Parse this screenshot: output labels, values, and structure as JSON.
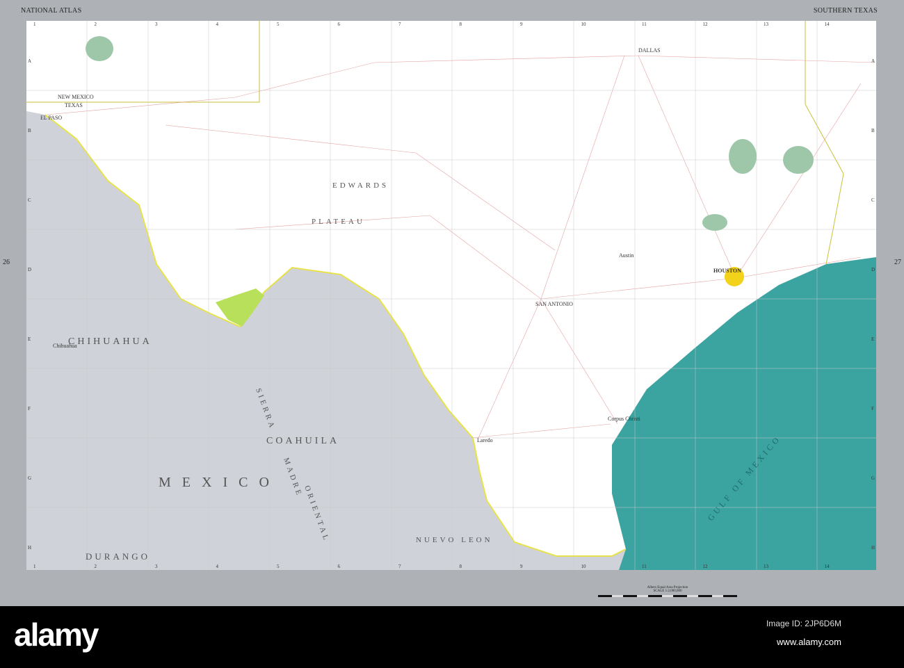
{
  "header": {
    "left": "NATIONAL ATLAS",
    "right": "SOUTHERN TEXAS"
  },
  "page_numbers": {
    "left": "26",
    "right": "27"
  },
  "map": {
    "colors": {
      "us_land": "#ffffff",
      "mexico": "#cfd2d8",
      "gulf": "#3ba4a1",
      "park": "#b9e05a",
      "forest": "#9dc7a8",
      "houston": "#f2d21b",
      "border": "#e8e24a"
    },
    "grid_columns": [
      "1",
      "2",
      "3",
      "4",
      "5",
      "6",
      "7",
      "8",
      "9",
      "10",
      "11",
      "12",
      "13",
      "14"
    ],
    "grid_rows": [
      "A",
      "B",
      "C",
      "D",
      "E",
      "F",
      "G",
      "H"
    ],
    "labels": {
      "new_mexico": "NEW MEXICO",
      "texas": "TEXAS",
      "el_paso": "EL PASO",
      "edwards": "EDWARDS",
      "plateau": "PLATEAU",
      "san_antonio": "SAN ANTONIO",
      "houston": "HOUSTON",
      "corpus": "Corpus Christi",
      "laredo": "Laredo",
      "chihuahua_state": "CHIHUAHUA",
      "chihuahua_city": "Chihuahua",
      "coahuila": "COAHUILA",
      "mexico": "MEXICO",
      "nuevo_leon": "NUEVO LEON",
      "durango": "DURANGO",
      "sierra": "SIERRA",
      "madre": "MADRE",
      "oriental": "ORIENTAL",
      "gulf": "GULF  OF  MEXICO",
      "dallas": "DALLAS",
      "austin": "Austin"
    }
  },
  "scale": {
    "projection": "Albers Equal Area Projection",
    "scale": "SCALE 1:2,000,000"
  },
  "footer": {
    "logo": "alamy",
    "image_id": "Image ID: 2JP6D6M",
    "site": "www.alamy.com"
  }
}
